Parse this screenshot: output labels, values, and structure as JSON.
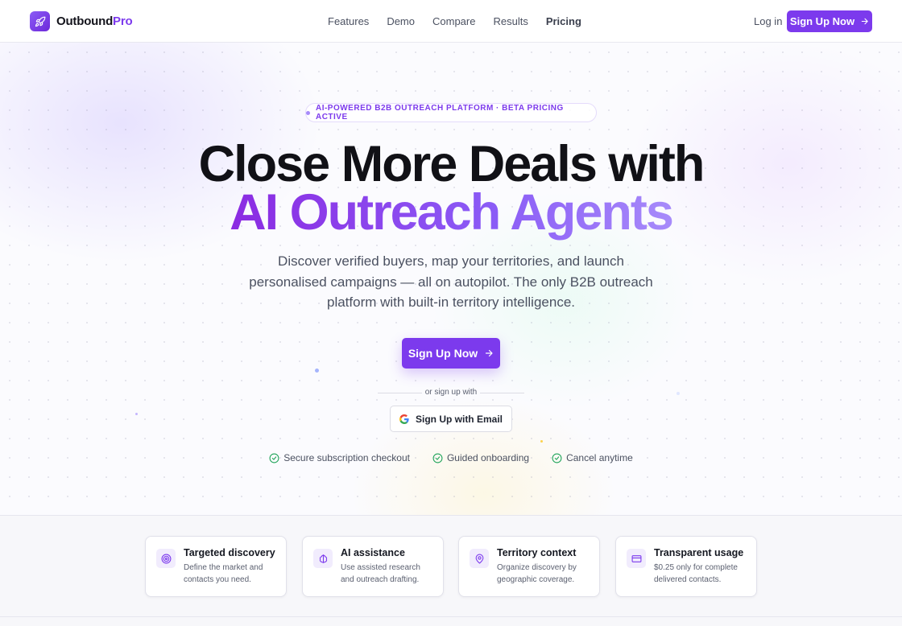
{
  "nav": {
    "brand_main": "Outbound",
    "brand_accent": "Pro",
    "links": [
      {
        "label": "Features"
      },
      {
        "label": "Demo"
      },
      {
        "label": "Compare"
      },
      {
        "label": "Results"
      },
      {
        "label": "Pricing"
      }
    ],
    "login": "Log in",
    "cta": "Sign Up Now"
  },
  "hero": {
    "badge": "AI-POWERED B2B OUTREACH PLATFORM · BETA PRICING ACTIVE",
    "headline_line1": "Close More Deals with",
    "headline_line2": "AI Outreach Agents",
    "description": "Discover verified buyers, map your territories, and launch personalised campaigns — all on autopilot. The only B2B outreach platform with built-in territory intelligence.",
    "cta": "Sign Up Now",
    "or_text": "or sign up with",
    "email_button": "Sign Up with Email",
    "checks": [
      {
        "label": "Secure subscription checkout"
      },
      {
        "label": "Guided onboarding"
      },
      {
        "label": "Cancel anytime"
      }
    ]
  },
  "features": [
    {
      "title": "Targeted discovery",
      "description": "Define the market and contacts you need.",
      "icon": "target-icon"
    },
    {
      "title": "AI assistance",
      "description": "Use assisted research and outreach drafting.",
      "icon": "brain-icon"
    },
    {
      "title": "Territory context",
      "description": "Organize discovery by geographic coverage.",
      "icon": "map-pin-icon"
    },
    {
      "title": "Transparent usage",
      "description": "$0.25 only for complete delivered contacts.",
      "icon": "credit-card-icon"
    }
  ],
  "colors": {
    "accent": "#7c3aed",
    "accent_light": "#a78bfa",
    "check": "#22a55b",
    "text": "#1f2430"
  }
}
